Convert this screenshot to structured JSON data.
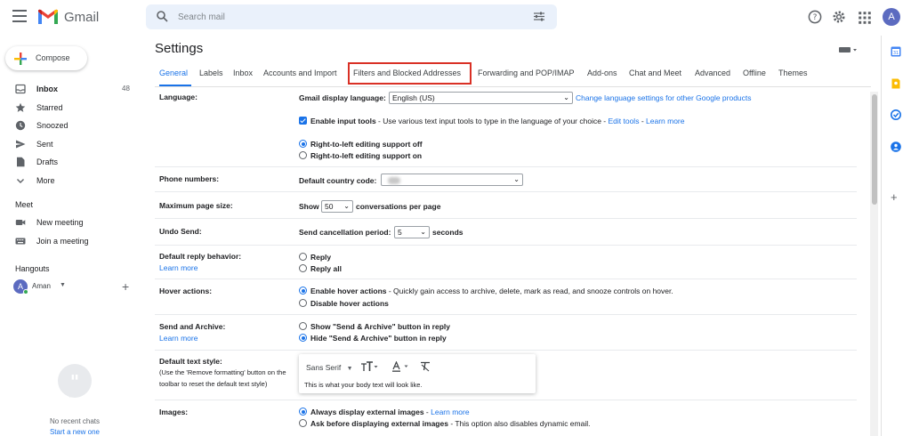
{
  "app": {
    "name": "Gmail"
  },
  "search": {
    "placeholder": "Search mail"
  },
  "user": {
    "initial": "A"
  },
  "compose": {
    "label": "Compose"
  },
  "nav": {
    "items": [
      {
        "label": "Inbox",
        "count": "48",
        "icon": "inbox-icon"
      },
      {
        "label": "Starred",
        "icon": "star-icon"
      },
      {
        "label": "Snoozed",
        "icon": "clock-icon"
      },
      {
        "label": "Sent",
        "icon": "send-icon"
      },
      {
        "label": "Drafts",
        "icon": "draft-icon"
      },
      {
        "label": "More",
        "icon": "chevron-down-icon"
      }
    ],
    "meet_title": "Meet",
    "meet_items": [
      {
        "label": "New meeting",
        "icon": "video-icon"
      },
      {
        "label": "Join a meeting",
        "icon": "keyboard-icon"
      }
    ],
    "hangouts_title": "Hangouts",
    "hangouts_user": "Aman",
    "no_chats": "No recent chats",
    "start_new": "Start a new one"
  },
  "settings": {
    "title": "Settings",
    "tabs": [
      "General",
      "Labels",
      "Inbox",
      "Accounts and Import",
      "Filters and Blocked Addresses",
      "Forwarding and POP/IMAP",
      "Add-ons",
      "Chat and Meet",
      "Advanced",
      "Offline",
      "Themes"
    ],
    "active_tab": "General",
    "highlighted_tab": "Filters and Blocked Addresses",
    "language": {
      "label": "Language:",
      "display_label": "Gmail display language:",
      "value": "English (US)",
      "change_link": "Change language settings for other Google products",
      "input_tools_label": "Enable input tools",
      "input_tools_desc": " - Use various text input tools to type in the language of your choice - ",
      "edit_tools": "Edit tools",
      "sep": " - ",
      "learn_more": "Learn more",
      "rtl_off": "Right-to-left editing support off",
      "rtl_on": "Right-to-left editing support on"
    },
    "phone": {
      "label": "Phone numbers:",
      "country_label": "Default country code:"
    },
    "page_size": {
      "label": "Maximum page size:",
      "show": "Show",
      "value": "50",
      "suffix": "conversations per page"
    },
    "undo": {
      "label": "Undo Send:",
      "period_label": "Send cancellation period:",
      "value": "5",
      "suffix": "seconds"
    },
    "reply": {
      "label": "Default reply behavior:",
      "learn_more": "Learn more",
      "reply": "Reply",
      "reply_all": "Reply all"
    },
    "hover": {
      "label": "Hover actions:",
      "enable": "Enable hover actions",
      "enable_desc": " - Quickly gain access to archive, delete, mark as read, and snooze controls on hover.",
      "disable": "Disable hover actions"
    },
    "send_archive": {
      "label": "Send and Archive:",
      "learn_more": "Learn more",
      "show": "Show \"Send & Archive\" button in reply",
      "hide": "Hide \"Send & Archive\" button in reply"
    },
    "text_style": {
      "label": "Default text style:",
      "note_1": "(Use the 'Remove formatting' button on the",
      "note_2": "toolbar to reset the default text style)",
      "font": "Sans Serif",
      "preview": "This is what your body text will look like."
    },
    "images": {
      "label": "Images:",
      "always": "Always display external images",
      "sep": " - ",
      "learn_more": "Learn more",
      "ask": "Ask before displaying external images",
      "ask_desc": " - This option also disables dynamic email."
    }
  },
  "colors": {
    "accent": "#1a73e8",
    "highlight": "#d93025",
    "search_bg": "#eaf1fb"
  }
}
